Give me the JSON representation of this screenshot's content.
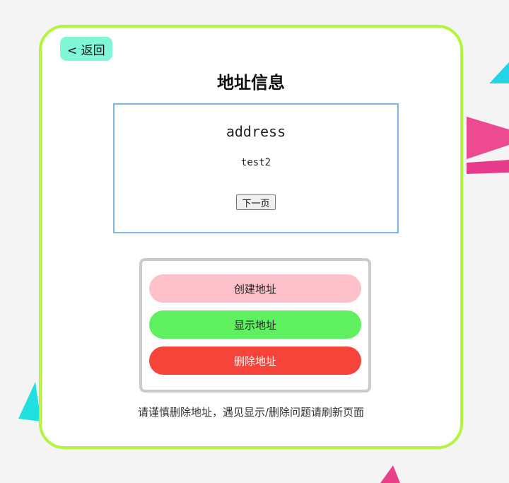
{
  "page": {
    "back_label": "< 返回",
    "title": "地址信息"
  },
  "info": {
    "label": "address",
    "value": "test2",
    "next_label": "下一页"
  },
  "actions": {
    "create_label": "创建地址",
    "show_label": "显示地址",
    "delete_label": "删除地址"
  },
  "note": "请谨慎删除地址，遇见显示/删除问题请刷新页面",
  "colors": {
    "card_border": "#b2f53a",
    "back_button": "#7ff7d6",
    "info_border": "#80b7e6",
    "create": "#fec0cb",
    "show": "#5ff05f",
    "delete": "#f7443a"
  }
}
